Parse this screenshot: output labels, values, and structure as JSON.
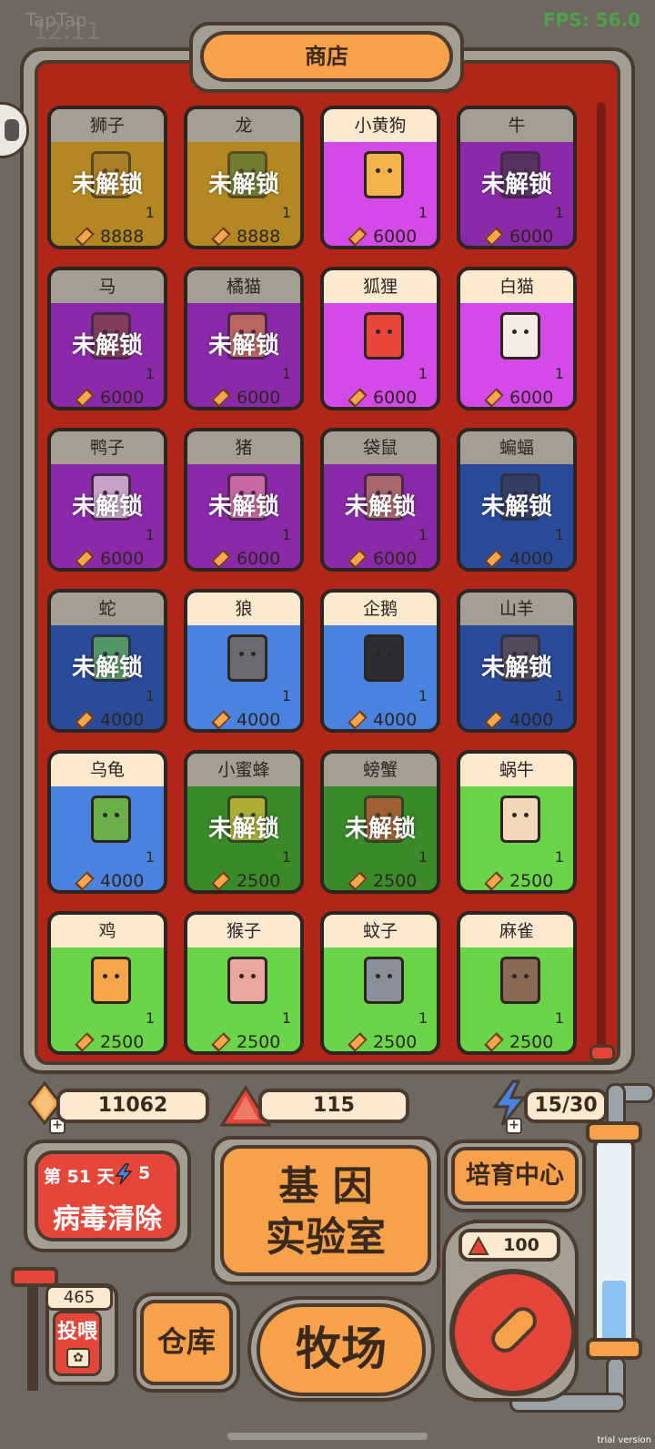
{
  "status_bar": {
    "app_label": "TapTap",
    "time": "12:11",
    "fps": "FPS: 56.0"
  },
  "shop": {
    "title": "商店",
    "locked_label": "未解锁"
  },
  "cards": [
    {
      "name": "狮子",
      "level": "1",
      "price": "8888",
      "locked": true,
      "color": "#b38822",
      "animal_color": "#a77a2e"
    },
    {
      "name": "龙",
      "level": "1",
      "price": "8888",
      "locked": true,
      "color": "#b38822",
      "animal_color": "#4c7a3a"
    },
    {
      "name": "小黄狗",
      "level": "1",
      "price": "6000",
      "locked": false,
      "color": "#d44ae8",
      "animal_color": "#f3b34a"
    },
    {
      "name": "牛",
      "level": "1",
      "price": "6000",
      "locked": true,
      "color": "#8a2aa8",
      "animal_color": "#3a3a3a"
    },
    {
      "name": "马",
      "level": "1",
      "price": "6000",
      "locked": true,
      "color": "#8a2aa8",
      "animal_color": "#7a4a2e"
    },
    {
      "name": "橘猫",
      "level": "1",
      "price": "6000",
      "locked": true,
      "color": "#8a2aa8",
      "animal_color": "#d8883a"
    },
    {
      "name": "狐狸",
      "level": "1",
      "price": "6000",
      "locked": false,
      "color": "#d44ae8",
      "animal_color": "#e8463a"
    },
    {
      "name": "白猫",
      "level": "1",
      "price": "6000",
      "locked": false,
      "color": "#d44ae8",
      "animal_color": "#f4ede4"
    },
    {
      "name": "鸭子",
      "level": "1",
      "price": "6000",
      "locked": true,
      "color": "#8a2aa8",
      "animal_color": "#e9e2d8"
    },
    {
      "name": "猪",
      "level": "1",
      "price": "6000",
      "locked": true,
      "color": "#8a2aa8",
      "animal_color": "#e88aa0"
    },
    {
      "name": "袋鼠",
      "level": "1",
      "price": "6000",
      "locked": true,
      "color": "#8a2aa8",
      "animal_color": "#b88a4a"
    },
    {
      "name": "蝙蝠",
      "level": "1",
      "price": "4000",
      "locked": true,
      "color": "#2a4a9a",
      "animal_color": "#3a3a4a"
    },
    {
      "name": "蛇",
      "level": "1",
      "price": "4000",
      "locked": true,
      "color": "#2a4a9a",
      "animal_color": "#6ac04a"
    },
    {
      "name": "狼",
      "level": "1",
      "price": "4000",
      "locked": false,
      "color": "#4a82e0",
      "animal_color": "#6a6a70"
    },
    {
      "name": "企鹅",
      "level": "1",
      "price": "4000",
      "locked": false,
      "color": "#4a82e0",
      "animal_color": "#2d2d33"
    },
    {
      "name": "山羊",
      "level": "1",
      "price": "4000",
      "locked": true,
      "color": "#2a4a9a",
      "animal_color": "#6a4a3a"
    },
    {
      "name": "乌龟",
      "level": "1",
      "price": "4000",
      "locked": false,
      "color": "#4a82e0",
      "animal_color": "#6ab04a"
    },
    {
      "name": "小蜜蜂",
      "level": "1",
      "price": "2500",
      "locked": true,
      "color": "#3a8a2a",
      "animal_color": "#e8c23a"
    },
    {
      "name": "螃蟹",
      "level": "1",
      "price": "2500",
      "locked": true,
      "color": "#3a8a2a",
      "animal_color": "#d84a3a"
    },
    {
      "name": "蜗牛",
      "level": "1",
      "price": "2500",
      "locked": false,
      "color": "#6ad44a",
      "animal_color": "#f2d8b8"
    },
    {
      "name": "鸡",
      "level": "1",
      "price": "2500",
      "locked": false,
      "color": "#6ad44a",
      "animal_color": "#f6a64a"
    },
    {
      "name": "猴子",
      "level": "1",
      "price": "2500",
      "locked": false,
      "color": "#6ad44a",
      "animal_color": "#e8a8a0"
    },
    {
      "name": "蚊子",
      "level": "1",
      "price": "2500",
      "locked": false,
      "color": "#6ad44a",
      "animal_color": "#8a8f99"
    },
    {
      "name": "麻雀",
      "level": "1",
      "price": "2500",
      "locked": false,
      "color": "#6ad44a",
      "animal_color": "#8a6a55"
    }
  ],
  "resources": {
    "gems": "11062",
    "rubies": "115",
    "energy": "15/30"
  },
  "virus_panel": {
    "day": "第 51 天",
    "energy_cost": "5",
    "title": "病毒清除"
  },
  "buttons": {
    "gene_lab_line1": "基 因",
    "gene_lab_line2": "实验室",
    "breeding_center": "培育中心",
    "warehouse": "仓库",
    "ranch": "牧场",
    "feed": "投喂",
    "feed_count": "465",
    "ruby_cost": "100"
  },
  "thermometer": {
    "fill_fraction": 0.32
  },
  "colors": {
    "accent_orange": "#f7a14a",
    "frame_red": "#b2261a",
    "outline": "#4b3a2e",
    "gem": "#f6a64a",
    "ruby": "#e5463a",
    "thermo_fill": "#8ec2f3"
  },
  "watermark": "trial version"
}
